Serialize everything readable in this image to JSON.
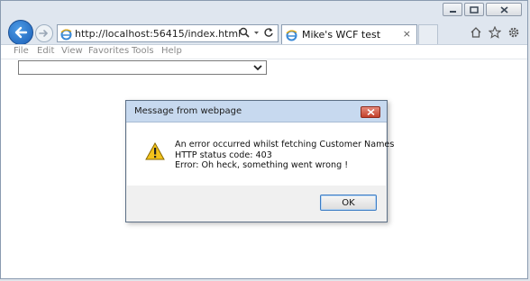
{
  "browser": {
    "address_url": "http://localhost:56415/index.html",
    "tab_title": "Mike's WCF test",
    "tab_close": "×"
  },
  "menu": {
    "file": "File",
    "edit": "Edit",
    "view": "View",
    "favorites": "Favorites",
    "tools": "Tools",
    "help": "Help"
  },
  "page": {
    "select_value": ""
  },
  "dialog": {
    "title": "Message from webpage",
    "lines": [
      "An error occurred whilst fetching Customer Names",
      "HTTP status code: 403",
      "Error: Oh heck, something went wrong !"
    ],
    "ok_label": "OK"
  },
  "icons": {
    "back": "back-arrow-icon",
    "forward": "forward-arrow-icon",
    "page": "ie-page-icon",
    "search": "search-icon",
    "refresh": "refresh-icon",
    "home": "home-icon",
    "favorites": "star-icon",
    "settings": "gear-icon",
    "warning": "warning-icon"
  },
  "colors": {
    "dialog_titlebar": "#c7d9ef",
    "close_red": "#c3402b",
    "accent_blue": "#1a5eb6"
  }
}
